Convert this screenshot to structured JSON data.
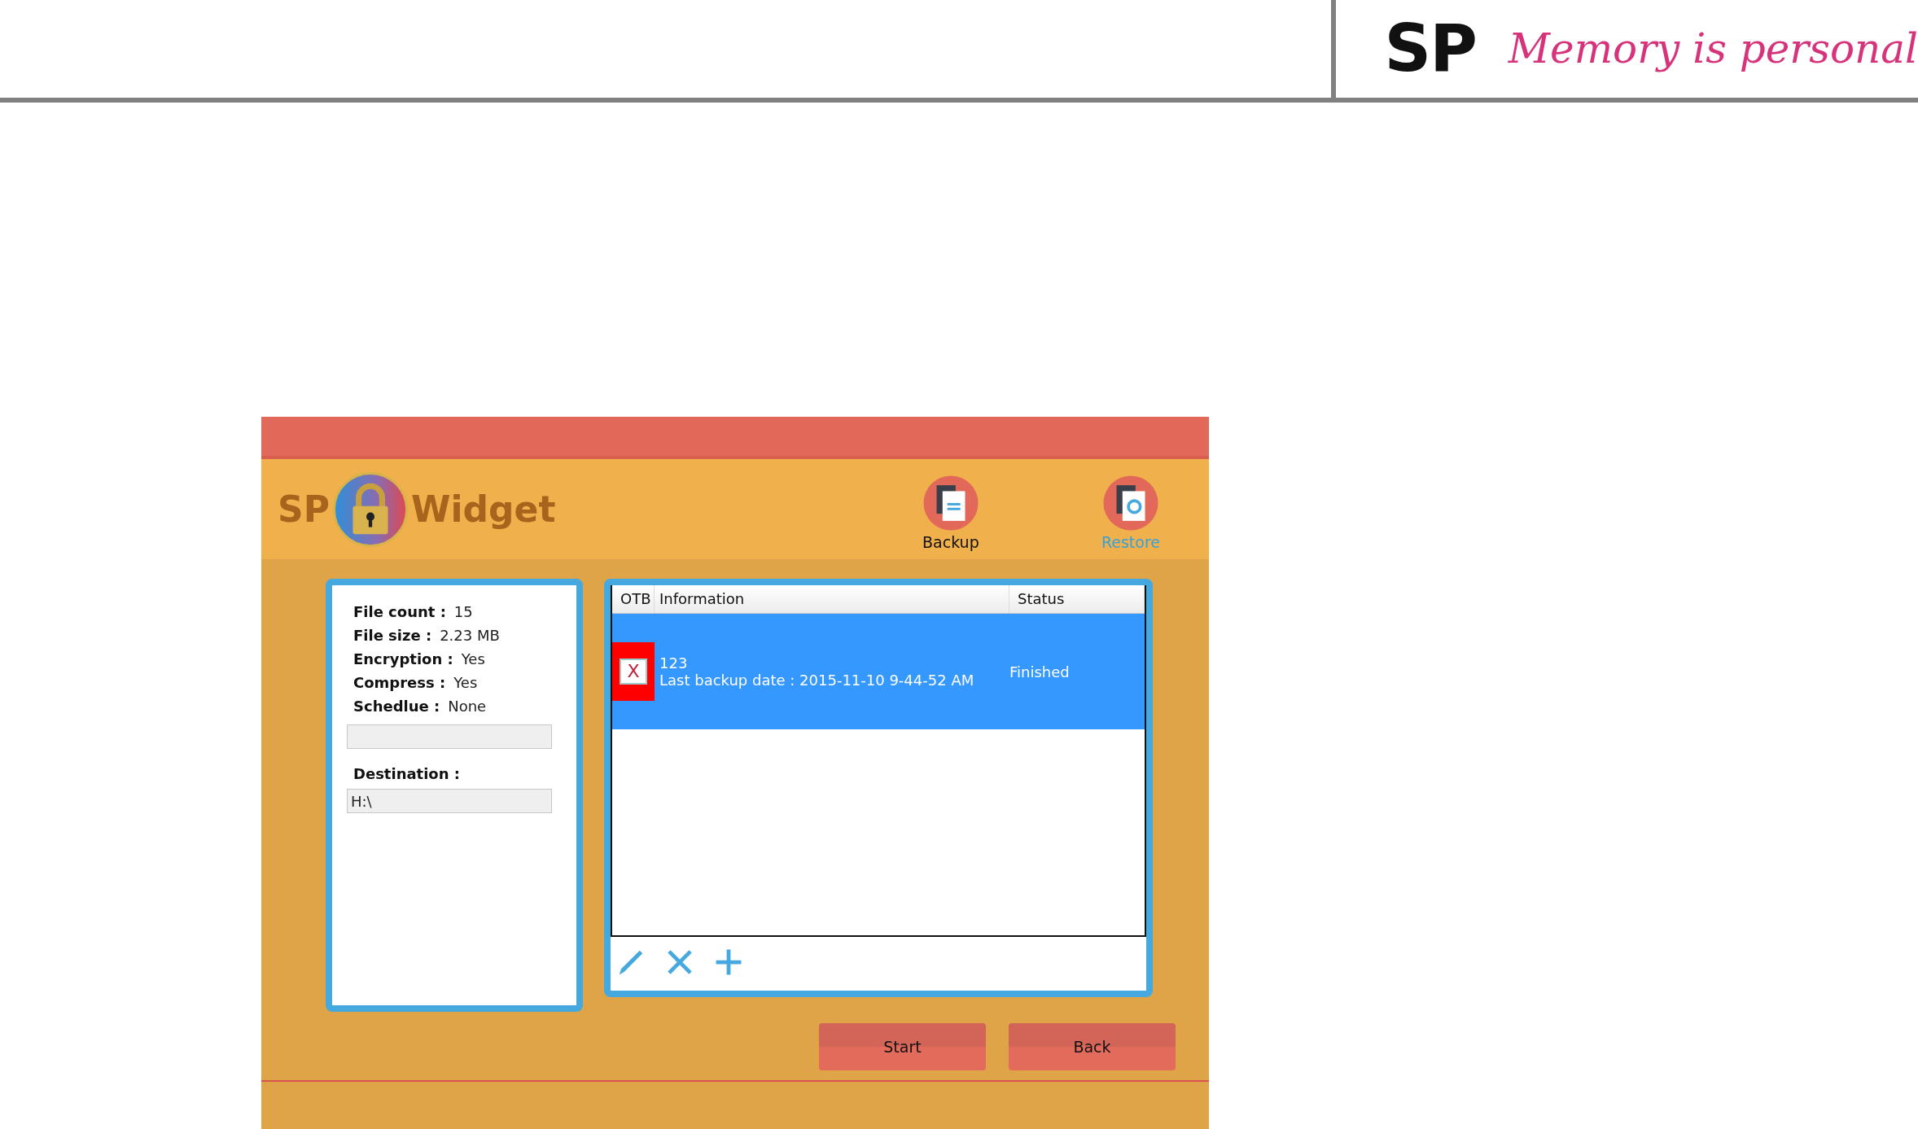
{
  "page_header": {
    "brand_logo": "SP",
    "slogan": "Memory is personal"
  },
  "app": {
    "logo": {
      "prefix": "SP",
      "name": "Widget"
    },
    "toolbar": [
      {
        "label": "Backup",
        "highlighted": false,
        "kind": "backup"
      },
      {
        "label": "Restore",
        "highlighted": true,
        "kind": "restore"
      }
    ],
    "summary": {
      "rows": [
        {
          "label": "File count :",
          "value": "15"
        },
        {
          "label": "File size :",
          "value": "2.23 MB"
        },
        {
          "label": "Encryption :",
          "value": "Yes"
        },
        {
          "label": "Compress :",
          "value": "Yes"
        },
        {
          "label": "Schedlue :",
          "value": "None"
        }
      ],
      "destination_label": "Destination :",
      "destination_value": "H:\\"
    },
    "table": {
      "columns": [
        "OTB",
        "Information",
        "Status"
      ],
      "rows": [
        {
          "selected": true,
          "otb_mark": "X",
          "name": "123",
          "info": "Last backup date : 2015-11-10 9-44-52 AM",
          "status": "Finished"
        }
      ]
    },
    "buttons": [
      "Start",
      "Back"
    ]
  }
}
